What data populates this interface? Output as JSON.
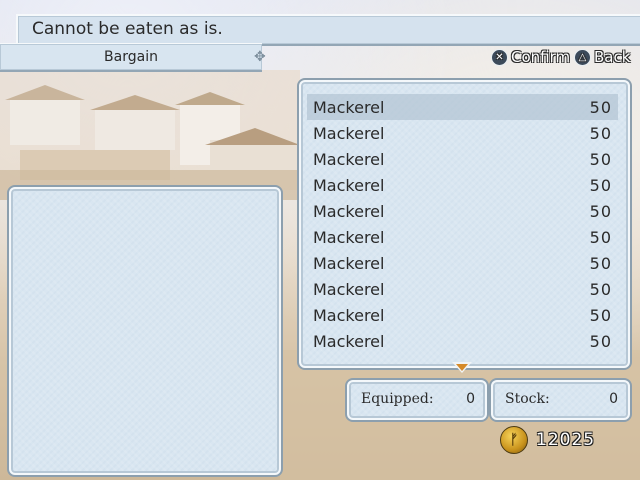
{
  "message": "Cannot be eaten as is.",
  "mode": "Bargain",
  "hints": [
    {
      "icon": "cross-button-icon",
      "glyph": "✕",
      "label": "Confirm"
    },
    {
      "icon": "triangle-button-icon",
      "glyph": "△",
      "label": "Back"
    }
  ],
  "items": [
    {
      "name": "Mackerel",
      "price": "50",
      "selected": true
    },
    {
      "name": "Mackerel",
      "price": "50",
      "selected": false
    },
    {
      "name": "Mackerel",
      "price": "50",
      "selected": false
    },
    {
      "name": "Mackerel",
      "price": "50",
      "selected": false
    },
    {
      "name": "Mackerel",
      "price": "50",
      "selected": false
    },
    {
      "name": "Mackerel",
      "price": "50",
      "selected": false
    },
    {
      "name": "Mackerel",
      "price": "50",
      "selected": false
    },
    {
      "name": "Mackerel",
      "price": "50",
      "selected": false
    },
    {
      "name": "Mackerel",
      "price": "50",
      "selected": false
    },
    {
      "name": "Mackerel",
      "price": "50",
      "selected": false
    }
  ],
  "stats": {
    "equipped": {
      "label": "Equipped:",
      "value": "0"
    },
    "stock": {
      "label": "Stock:",
      "value": "0"
    }
  },
  "gold": {
    "icon": "gold-coin-icon",
    "amount": "12025"
  },
  "colors": {
    "panel": "#d9e6f1",
    "selected_row": "#b4c6d4",
    "arrow": "#d58a2a"
  }
}
